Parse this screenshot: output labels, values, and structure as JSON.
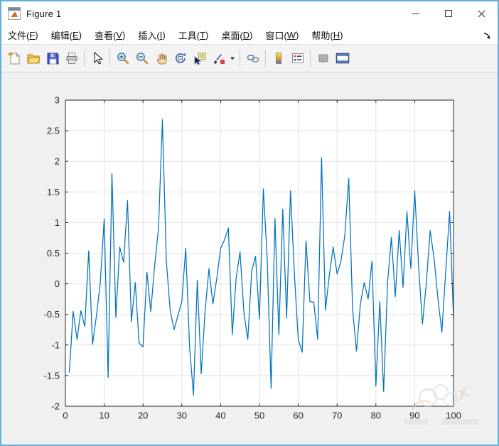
{
  "window": {
    "title": "Figure 1",
    "controls": [
      "minimize-button",
      "maximize-button",
      "close-button"
    ]
  },
  "menu": {
    "items": [
      {
        "label": "文件",
        "mnemonic": "F"
      },
      {
        "label": "编辑",
        "mnemonic": "E"
      },
      {
        "label": "查看",
        "mnemonic": "V"
      },
      {
        "label": "插入",
        "mnemonic": "I"
      },
      {
        "label": "工具",
        "mnemonic": "T"
      },
      {
        "label": "桌面",
        "mnemonic": "D"
      },
      {
        "label": "窗口",
        "mnemonic": "W"
      },
      {
        "label": "帮助",
        "mnemonic": "H"
      }
    ],
    "dock_icon": "dock-figure-arrow"
  },
  "toolbar": {
    "icons": [
      "new-figure",
      "open-file",
      "save-figure",
      "print-figure",
      "edit-plot-cursor",
      "zoom-in",
      "zoom-out",
      "pan-hand",
      "rotate-3d",
      "data-cursor",
      "brush-data",
      "brush-dropdown",
      "link-plot",
      "insert-colorbar",
      "insert-legend",
      "hide-plot-tools",
      "show-plot-tools"
    ]
  },
  "chart_data": {
    "type": "line",
    "title": "",
    "xlabel": "",
    "ylabel": "",
    "xlim": [
      0,
      100
    ],
    "ylim": [
      -2,
      3
    ],
    "grid": true,
    "legend": "none",
    "line_color": "#0072BD",
    "xticks": [
      0,
      10,
      20,
      30,
      40,
      50,
      60,
      70,
      80,
      90,
      100
    ],
    "xticklabels": [
      "0",
      "10",
      "20",
      "30",
      "40",
      "50",
      "60",
      "70",
      "80",
      "90",
      "100"
    ],
    "yticks": [
      -2,
      -1.5,
      -1,
      -0.5,
      0,
      0.5,
      1,
      1.5,
      2,
      2.5,
      3
    ],
    "yticklabels": [
      "-2",
      "-1.5",
      "-1",
      "-0.5",
      "0",
      "0.5",
      "1",
      "1.5",
      "2",
      "2.5",
      "3"
    ],
    "x_start": 1,
    "x_step": 1,
    "values": [
      -1.45,
      -0.45,
      -0.91,
      -0.44,
      -0.7,
      0.54,
      -0.99,
      -0.52,
      0.02,
      1.06,
      -1.53,
      1.8,
      -0.55,
      0.6,
      0.35,
      1.36,
      -0.62,
      0.02,
      -0.97,
      -1.03,
      0.19,
      -0.45,
      0.3,
      0.91,
      2.68,
      0.37,
      -0.43,
      -0.75,
      -0.52,
      -0.29,
      0.58,
      -1.03,
      -1.82,
      0.06,
      -1.47,
      -0.43,
      0.25,
      -0.33,
      0.08,
      0.58,
      0.72,
      0.91,
      -0.83,
      0.1,
      0.52,
      -0.48,
      -0.91,
      0.21,
      0.45,
      -0.58,
      1.55,
      0.41,
      -1.71,
      1.07,
      -0.83,
      1.22,
      -0.56,
      1.52,
      0.17,
      -0.91,
      -1.12,
      0.7,
      -0.29,
      -0.3,
      -0.91,
      2.06,
      -0.43,
      0.14,
      0.6,
      0.16,
      0.37,
      0.79,
      1.72,
      -0.41,
      -1.1,
      -0.33,
      0.02,
      -0.25,
      0.37,
      -1.67,
      -0.29,
      -1.76,
      0.02,
      0.76,
      -0.21,
      0.87,
      -0.06,
      1.18,
      0.25,
      1.52,
      0.29,
      -0.66,
      0.02,
      0.87,
      0.41,
      -0.25,
      -0.79,
      0.21,
      1.18,
      -0.56
    ]
  },
  "colors": {
    "window_border": "#5fafe1",
    "figure_bg": "#f0f0f0",
    "plot_bg": "#ffffff",
    "grid": "#e3e3e3",
    "axis": "#262626",
    "line": "#0072BD"
  }
}
